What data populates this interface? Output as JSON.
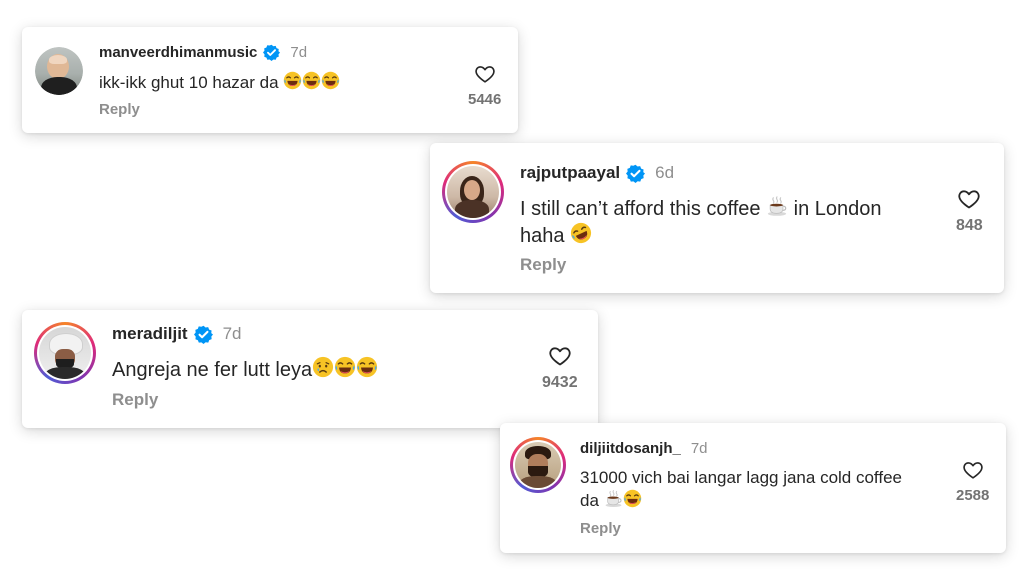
{
  "comments": [
    {
      "username": "manveerdhimanmusic",
      "time": "7d",
      "text": "ikk-ikk ghut 10 hazar da",
      "emoji": [
        "laughing",
        "laughing",
        "laughing"
      ],
      "reply": "Reply",
      "likes": "5446",
      "verified": true,
      "story_ring": false
    },
    {
      "username": "rajputpaayal",
      "time": "6d",
      "text_line1": "I still can’t afford this coffee",
      "emoji_mid": "hot-beverage",
      "text_line1_end": "in London",
      "text_line2": "haha",
      "emoji": [
        "rofl"
      ],
      "reply": "Reply",
      "likes": "848",
      "verified": true,
      "story_ring": true
    },
    {
      "username": "meradiljit",
      "time": "7d",
      "text": "Angreja ne fer lutt leya",
      "emoji": [
        "crying",
        "laughing",
        "laughing"
      ],
      "reply": "Reply",
      "likes": "9432",
      "verified": true,
      "story_ring": true
    },
    {
      "username": "diljiitdosanjh_",
      "time": "7d",
      "text_line1": "31000 vich bai langar lagg jana cold coffee",
      "text_line2": "da",
      "emoji": [
        "hot-beverage",
        "laughing"
      ],
      "reply": "Reply",
      "likes": "2588",
      "verified": false,
      "story_ring": true
    }
  ],
  "colors": {
    "verified_blue": "#0095f6",
    "text_primary": "#262626",
    "text_secondary": "#8e8e8e",
    "emoji_yellow": "#f7c325"
  }
}
